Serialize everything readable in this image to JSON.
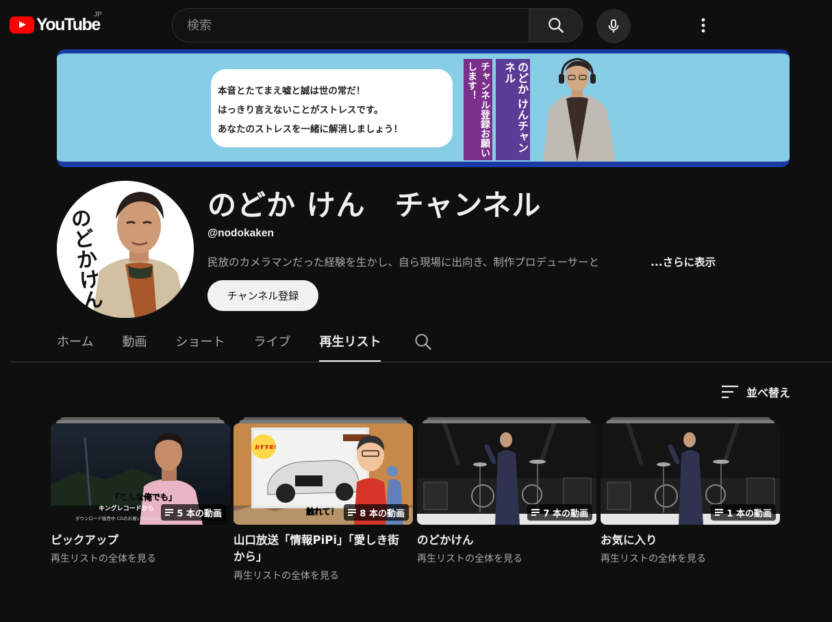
{
  "header": {
    "logo_text": "YouTube",
    "region": "JP",
    "search_placeholder": "検索"
  },
  "banner": {
    "lines": [
      "本音とたてまえ嘘と誠は世の常だ！",
      "はっきり言えないことがストレスです。",
      "あなたのストレスを一緒に解消しましょう！"
    ],
    "vertical_1": "チャンネル登録お願いします！",
    "vertical_2": "のどか けんチャンネル",
    "colors": {
      "sky": "#87cde6",
      "frame": "#1b3aa5",
      "purple": "#6b3a93"
    }
  },
  "channel": {
    "avatar_text": "のどかけん",
    "title": "のどか けん　チャンネル",
    "handle": "@nodokaken",
    "description": "民放のカメラマンだった経験を生かし、自ら現場に出向き、制作プロデューサーと",
    "more_label": "...さらに表示",
    "subscribe_label": "チャンネル登録"
  },
  "tabs": [
    {
      "label": "ホーム",
      "active": false
    },
    {
      "label": "動画",
      "active": false
    },
    {
      "label": "ショート",
      "active": false
    },
    {
      "label": "ライブ",
      "active": false
    },
    {
      "label": "再生リスト",
      "active": true
    }
  ],
  "sort": {
    "label": "並べ替え"
  },
  "playlists": [
    {
      "title": "ピックアップ",
      "count": "5 本の動画",
      "view_all": "再生リストの全体を見る",
      "thumb_caption": "「こんな俺でも」",
      "thumb_caption2": "キングレコードから",
      "thumb_caption3": "ダウンロード販売中 CDのお買い求めはお近くの"
    },
    {
      "title": "山口放送「情報PiPi」「愛しき街から」",
      "count": "8 本の動画",
      "view_all": "再生リストの全体を見る",
      "thumb_caption": "触れて！",
      "thumb_badge": "おすすめ！"
    },
    {
      "title": "のどかけん",
      "count": "7 本の動画",
      "view_all": "再生リストの全体を見る"
    },
    {
      "title": "お気に入り",
      "count": "1 本の動画",
      "view_all": "再生リストの全体を見る"
    }
  ]
}
